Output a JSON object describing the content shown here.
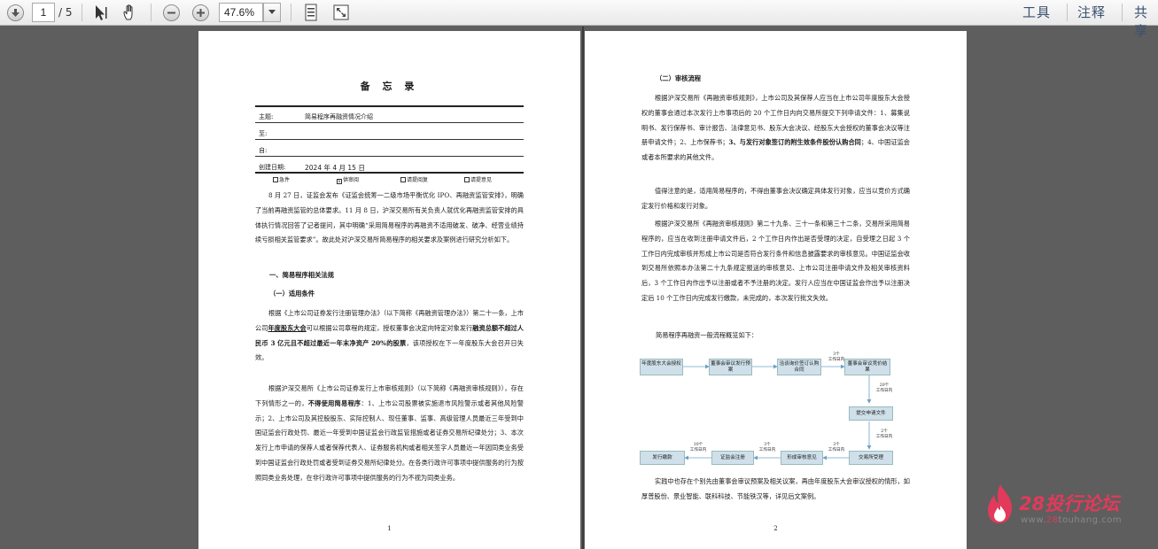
{
  "toolbar": {
    "page_current": "1",
    "page_total": "/ 5",
    "zoom": "47.6%",
    "links": [
      "工具",
      "注释",
      "共享"
    ]
  },
  "page1": {
    "title": "备 忘 录",
    "memo": [
      {
        "label": "主题:",
        "value": "简易程序再融资情况介绍"
      },
      {
        "label": "至:",
        "value": ""
      },
      {
        "label": "自:",
        "value": ""
      },
      {
        "label": "创建日期:",
        "value": "2024 年 4 月 15 日"
      }
    ],
    "checks": [
      {
        "label": "急件",
        "mark": ""
      },
      {
        "label": "供审阅",
        "mark": "x"
      },
      {
        "label": "请提阅复",
        "mark": ""
      },
      {
        "label": "请提意见",
        "mark": ""
      }
    ],
    "para1": "8 月 27 日，证监会发布《证监会统筹一二级市场平衡优化 IPO、再融资监管安排》，明确了当前再融资监管的总体要求。11 月 8 日，沪深交易所有关负责人就优化再融资监管安排的具体执行情况回答了记者提问，其中明确“采用简易程序的再融资不适用破发、破净、经营业绩持续亏损相关监管要求”。故此处对沪深交易所简易程序的相关要求及案例进行研究分析如下。",
    "h1": "一、简易程序相关法规",
    "h2": "（一）适用条件",
    "para2a": "根据《上市公司证券发行注册管理办法》（以下简称《再融资管理办法》）第二十一条，上市公司",
    "para2u": "年度股东大会",
    "para2b": "可以根据公司章程的规定，授权董事会决定向特定对象发行",
    "para2c": "融资总额不超过人民币 3 亿元且不超过最近一年末净资产 20%的股票",
    "para2d": "，该项授权在下一年度股东大会召开日失效。",
    "para3a": "根据沪深交易所《上市公司证券发行上市审核规则》（以下简称《再融资审核规则》），存在下列情形之一的，",
    "para3b": "不得使用简易程序",
    "para3c": "：1、上市公司股票被实施退市风险警示或者其他风险警示；2、上市公司及其控股股东、实际控制人、现任董事、监事、高级管理人员最近三年受到中国证监会行政处罚、最近一年受到中国证监会行政监管措施或者证券交易所纪律处分；3、本次发行上市申请的保荐人或者保荐代表人、证券服务机构或者相关签字人员最近一年因同类业务受到中国证监会行政处罚或者受到证券交易所纪律处分。在各类行政许可事项中提供服务的行为按照同类业务处理，在非行政许可事项中提供服务的行为不视为同类业务。",
    "page_number": "1"
  },
  "page2": {
    "h2": "（二）审核流程",
    "para1a": "根据沪深交易所《再融资审核规则》，上市公司及其保荐人应当在上市公司年度股东大会授权的董事会通过本次发行上市事项后的 20 个工作日内向交易所提交下列申请文件：1、募集说明书、发行保荐书、审计报告、法律意见书、股东大会决议、经股东大会授权的董事会决议等注册申请文件；2、上市保荐书；",
    "para1b": "3、与发行对象签订的附生效条件股份认购合同",
    "para1c": "；4、中国证监会或者本所要求的其他文件。",
    "para2": "值得注意的是，适用简易程序的，不得由董事会决议确定具体发行对象，应当以竞价方式确定发行价格和发行对象。",
    "para3": "根据沪深交易所《再融资审核规则》第二十九条、三十一条和第三十二条，交易所采用简易程序的，应当在收到注册申请文件后，2 个工作日内作出是否受理的决定，自受理之日起 3 个工作日内完成审核并形成上市公司是否符合发行条件和信息披露要求的审核意见。中国证监会收到交易所依照本办法第二十九条规定报送的审核意见、上市公司注册申请文件及相关审核资料后，3 个工作日内作出予以注册或者不予注册的决定。发行人应当在中国证监会作出予以注册决定后 10 个工作日内完成发行缴款，未完成的，本次发行批文失效。",
    "para4": "简易程序再融资一般流程概览如下：",
    "flow": {
      "boxes": [
        "年度股东大会授权",
        "董事会审议发行预案",
        "洽谈询价签订认购合同",
        "董事会审议竞价结果",
        "提交申请文件",
        "交易所受理",
        "形成审核意见",
        "证监会注册",
        "发行缴款"
      ],
      "labels": [
        {
          "n": "3个",
          "t": "工作日内"
        },
        {
          "n": "20个",
          "t": "工作日内"
        },
        {
          "n": "2个",
          "t": "工作日内"
        },
        {
          "n": "3个",
          "t": "工作日内"
        },
        {
          "n": "3个",
          "t": "工作日内"
        },
        {
          "n": "10个",
          "t": "工作日内"
        }
      ]
    },
    "para5": "实践中也存在个别先由董事会审议预案及相关议案，再由年度股东大会审议授权的情形，如厚普股份、景业智能、联科科技、节能铁汉等，详见后文案例。",
    "page_number": "2"
  },
  "watermark": {
    "brand": "28投行论坛",
    "url_prefix": "www.",
    "url_accent": "28",
    "url_suffix": "touhang.com"
  }
}
